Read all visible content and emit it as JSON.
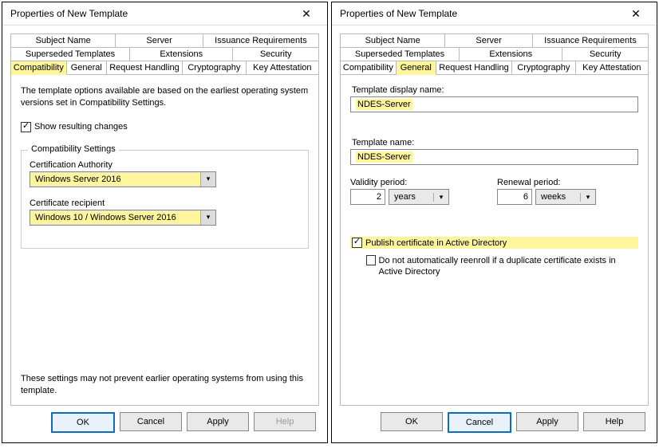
{
  "windows": [
    {
      "title": "Properties of New Template",
      "tabs_row1": [
        "Subject Name",
        "Server",
        "Issuance Requirements"
      ],
      "tabs_row2": [
        "Superseded Templates",
        "Extensions",
        "Security"
      ],
      "tabs_row3": [
        "Compatibility",
        "General",
        "Request Handling",
        "Cryptography",
        "Key Attestation"
      ],
      "active_tab": "Compatibility",
      "compat": {
        "description": "The template options available are based on the earliest operating system versions set in Compatibility Settings.",
        "show_resulting_changes_label": "Show resulting changes",
        "show_resulting_changes_checked": true,
        "fieldset_legend": "Compatibility Settings",
        "cert_authority_label": "Certification Authority",
        "cert_authority_value": "Windows Server 2016",
        "cert_recipient_label": "Certificate recipient",
        "cert_recipient_value": "Windows 10 / Windows Server 2016",
        "footnote": "These settings may not prevent earlier operating systems from using this template."
      },
      "buttons": {
        "ok": "OK",
        "cancel": "Cancel",
        "apply": "Apply",
        "help": "Help"
      },
      "default_button": "ok",
      "disabled_button": "help"
    },
    {
      "title": "Properties of New Template",
      "tabs_row1": [
        "Subject Name",
        "Server",
        "Issuance Requirements"
      ],
      "tabs_row2": [
        "Superseded Templates",
        "Extensions",
        "Security"
      ],
      "tabs_row3": [
        "Compatibility",
        "General",
        "Request Handling",
        "Cryptography",
        "Key Attestation"
      ],
      "active_tab": "General",
      "general": {
        "display_name_label": "Template display name:",
        "display_name_value": "NDES-Server",
        "template_name_label": "Template name:",
        "template_name_value": "NDES-Server",
        "validity_label": "Validity period:",
        "validity_value": "2",
        "validity_unit": "years",
        "renewal_label": "Renewal period:",
        "renewal_value": "6",
        "renewal_unit": "weeks",
        "publish_ad_label": "Publish certificate in Active Directory",
        "publish_ad_checked": true,
        "no_reenroll_label": "Do not automatically reenroll if a duplicate certificate exists in Active Directory",
        "no_reenroll_checked": false
      },
      "buttons": {
        "ok": "OK",
        "cancel": "Cancel",
        "apply": "Apply",
        "help": "Help"
      },
      "default_button": "cancel"
    }
  ],
  "close_symbol": "✕"
}
